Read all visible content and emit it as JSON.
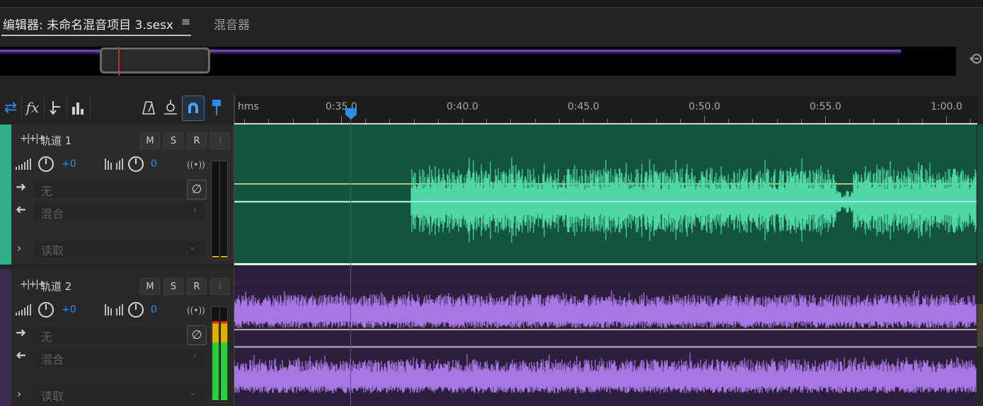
{
  "tabs": {
    "editor": "编辑器: 未命名混音项目 3.sesx",
    "menu_icon": "≡",
    "mixer": "混音器"
  },
  "toolbar": {
    "fx_label": "fx"
  },
  "ruler": {
    "unit": "hms",
    "labels": [
      "0:35.0",
      "0:40.0",
      "0:45.0",
      "0:50.0",
      "0:55.0",
      "1:00.0"
    ]
  },
  "tracks": [
    {
      "name": "轨道 1",
      "color": "#2fae8a",
      "m": "M",
      "s": "S",
      "r": "R",
      "i": "I",
      "volume": "+0",
      "pan": "0",
      "input": "无",
      "output": "混合",
      "automation": "读取"
    },
    {
      "name": "轨道 2",
      "color": "#3a2b4f",
      "m": "M",
      "s": "S",
      "r": "R",
      "i": "I",
      "volume": "+0",
      "pan": "0",
      "input": "无",
      "output": "混合",
      "automation": "读取"
    }
  ],
  "colors": {
    "accent": "#2d8ceb",
    "playhead": "#c0302c",
    "track1_wave": "#4fd8a6",
    "track2_wave": "#a877e4"
  }
}
